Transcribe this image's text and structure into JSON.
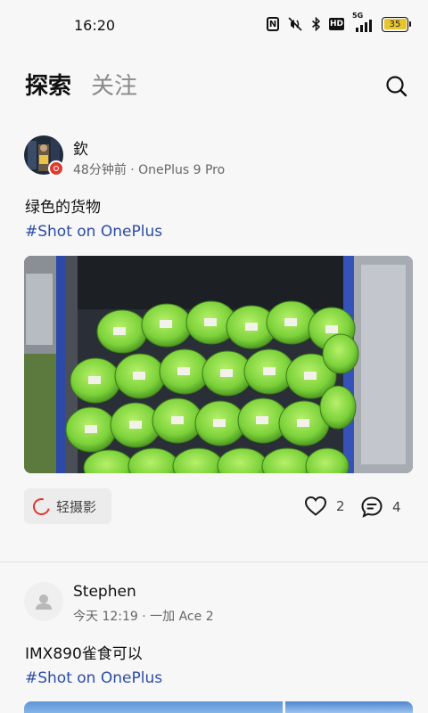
{
  "status_bar": {
    "time": "16:20",
    "icons": [
      "nfc-icon",
      "mute-vibrate-icon",
      "bluetooth-icon",
      "hd-icon",
      "5g-signal-icon"
    ],
    "net_label": "5G",
    "hd_label": "HD",
    "battery_level": "35"
  },
  "tabs": [
    {
      "label": "探索",
      "active": true
    },
    {
      "label": "关注",
      "active": false
    }
  ],
  "posts": [
    {
      "user_name": "欽",
      "meta": "48分钟前 · OnePlus 9 Pro",
      "caption": "绿色的货物",
      "hashtag": "#Shot on OnePlus",
      "light_button_label": "轻摄影",
      "like_count": "2",
      "comment_count": "4"
    },
    {
      "user_name": "Stephen",
      "meta": "今天 12:19 · 一加 Ace 2",
      "caption": "IMX890雀食可以",
      "hashtag": "#Shot on OnePlus"
    }
  ],
  "colors": {
    "accent_hashtag": "#2b4ca8",
    "brand_red": "#e03b2f",
    "battery_yellow": "#e6c62c"
  }
}
